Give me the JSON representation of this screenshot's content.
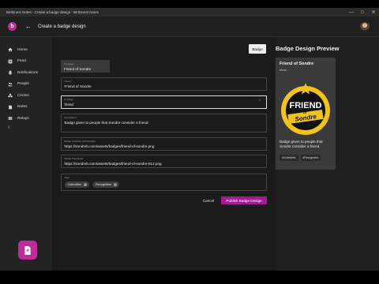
{
  "window": {
    "title": "Birdsnest Notes - Create a badge design - Birdsnest Notes",
    "minimize": "—",
    "maximize": "□",
    "close": "✕"
  },
  "appbar": {
    "logo": "b",
    "back": "←",
    "title": "Create a badge design"
  },
  "sidebar": {
    "items": [
      {
        "label": "Home",
        "icon": "home-icon"
      },
      {
        "label": "Feed",
        "icon": "feed-icon"
      },
      {
        "label": "Notifications",
        "icon": "bell-icon"
      },
      {
        "label": "People",
        "icon": "people-icon"
      },
      {
        "label": "Circles",
        "icon": "circles-icon"
      },
      {
        "label": "Notes",
        "icon": "notes-icon"
      },
      {
        "label": "Relays",
        "icon": "relays-icon"
      }
    ],
    "collapse": "‹"
  },
  "form": {
    "badge_button": "Badge",
    "template": {
      "label": "Template",
      "value": "Friend of Sondre"
    },
    "name": {
      "label": "Name*",
      "value": "Friend of Sondre"
    },
    "id": {
      "label": "Id (slug)",
      "value": "friend",
      "chevron": "⌃"
    },
    "description": {
      "label": "Description*",
      "value": "Badge given to people that Sondre consider a friend."
    },
    "graphics": {
      "label": "Badge Graphics (1024x1024)",
      "value": "https://sondreb.com/assets/badges/friend-of-sondre.png"
    },
    "thumbnail": {
      "label": "Badge Thumbnail",
      "value": "https://sondreb.com/assets/badges/friend-of-sondre-512.png"
    },
    "tags": {
      "label": "Tags",
      "items": [
        "Collectible",
        "Recognition"
      ]
    },
    "cancel": "Cancel",
    "publish": "Publish Badge Design"
  },
  "preview": {
    "heading": "Badge Design Preview",
    "name": "Friend of Sondre",
    "slug": "friend",
    "badge_top": "FRIEND",
    "badge_of": "OF",
    "badge_bottom": "Sondre",
    "description": "Badge given to people that Sondre consider a friend.",
    "tags": [
      "#Collectible",
      "#Recognition"
    ]
  },
  "colors": {
    "accent": "#c22a9b",
    "publish": "#a21c96",
    "badge_ring": "#f2c418"
  }
}
